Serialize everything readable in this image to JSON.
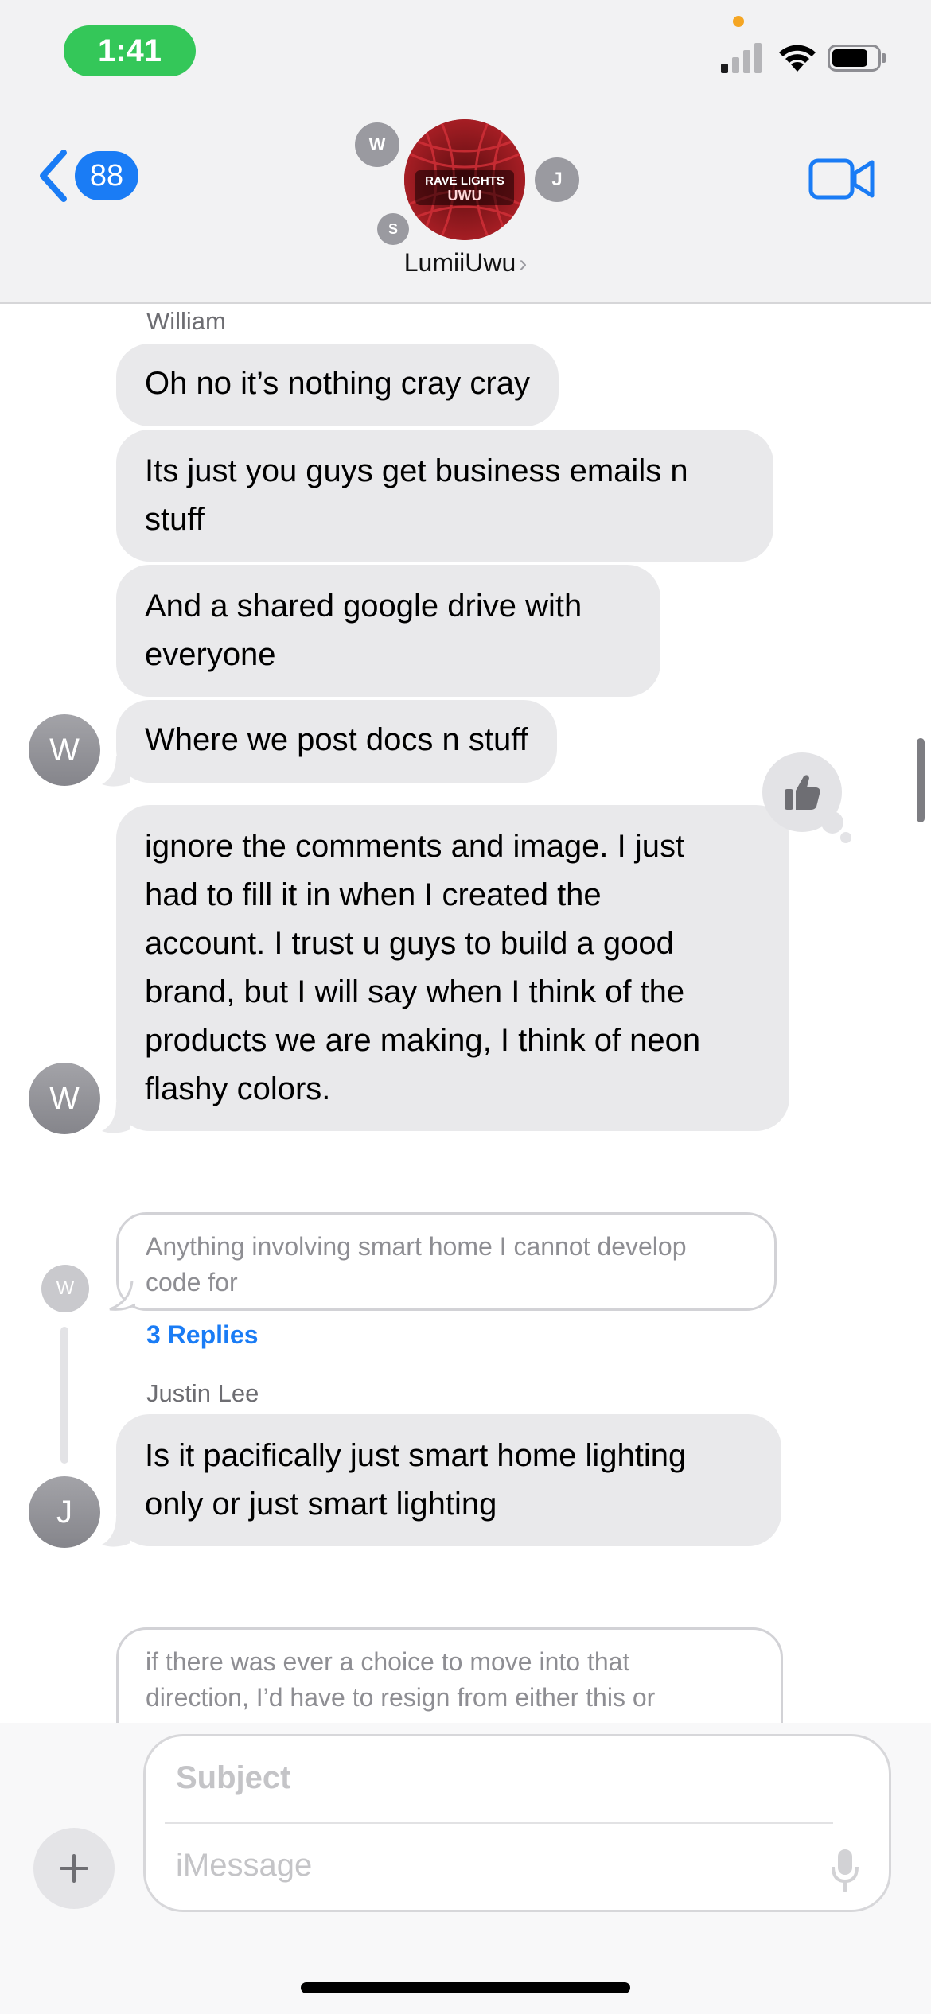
{
  "status_bar": {
    "time": "1:41"
  },
  "header": {
    "back_count": "88",
    "group_name": "LumiiUwu",
    "group_name_chevron": "›",
    "participants": [
      {
        "initial": "W"
      },
      {
        "initial": "J"
      },
      {
        "initial": "S"
      }
    ],
    "group_avatar_text_top": "RAVE LIGHTS",
    "group_avatar_text_bottom": "UWU"
  },
  "transcript": {
    "sender_william": "William",
    "messages_william": [
      "Oh no it’s nothing cray cray",
      "Its just you guys get business emails n\nstuff",
      "And a shared google drive with\neveryone",
      "Where we post docs n stuff",
      "ignore the comments and image. I just\nhad to fill it in when I created the\naccount. I trust u guys to build a good\nbrand, but I will say when I think of the\nproducts we are making, I think of neon\nflashy colors."
    ],
    "avatar_w": "W",
    "tapback": "thumbs-up",
    "thread": {
      "quoted_text": "Anything involving smart home I cannot develop\ncode for",
      "quoted_avatar": "W",
      "replies_label": "3 Replies",
      "sender": "Justin Lee",
      "reply_text": "Is it pacifically just smart home lighting\nonly or just smart lighting",
      "reply_avatar": "J"
    },
    "partial_quote": "if there was ever a choice to move into that\ndirection, I’d have to resign from either this or"
  },
  "compose": {
    "subject_placeholder": "Subject",
    "message_placeholder": "iMessage"
  },
  "colors": {
    "accent": "#1a7cf5",
    "time_pill": "#34c759",
    "incoming_bubble": "#e9e9eb",
    "group_avatar": "#8c1a1e"
  }
}
